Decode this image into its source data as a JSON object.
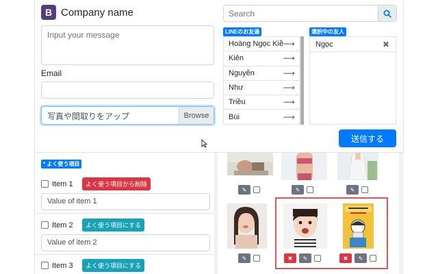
{
  "brand": {
    "logo": "B",
    "name": "Company name"
  },
  "message": {
    "placeholder": "Input your message"
  },
  "email": {
    "label": "Email",
    "value": ""
  },
  "upload": {
    "placeholder": "写真や間取りをアップ",
    "button": "Browse"
  },
  "search": {
    "placeholder": "Search",
    "icon": "search-icon"
  },
  "friends": {
    "title": "LINEのお友達",
    "items": [
      "Hoàng Ngọc Kiề...",
      "Kiên",
      "Nguyễn",
      "Như",
      "Triều",
      "Bùi"
    ]
  },
  "selected": {
    "title": "選択中の友人",
    "items": [
      "Ngọc"
    ]
  },
  "send_button": "送信する",
  "favorites": {
    "title": "* よく使う項目",
    "items": [
      {
        "name": "Item 1",
        "action": "よく使う項目から削除",
        "action_color": "#dc3545",
        "value": "Value of item 1"
      },
      {
        "name": "Item 2",
        "action": "よく使う項目にする",
        "action_color": "#17a2b8",
        "value": "Value of item 2"
      },
      {
        "name": "Item 3",
        "action": "よく使う項目にする",
        "action_color": "#17a2b8",
        "value": ""
      }
    ]
  },
  "colors": {
    "primary": "#007bff",
    "danger": "#dc3545",
    "info": "#17a2b8",
    "brand": "#563d7c",
    "highlight": "#e0545a"
  }
}
